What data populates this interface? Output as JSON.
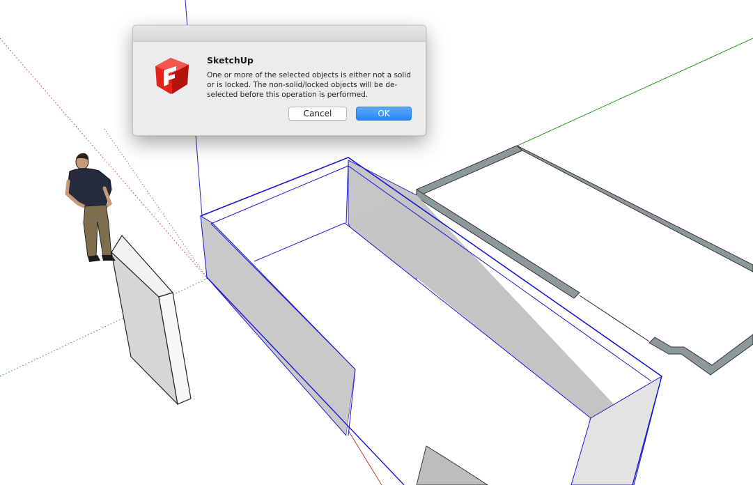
{
  "dialog": {
    "app_icon": "sketchup-logo-icon",
    "title": "SketchUp",
    "message": "One or more of the selected objects is either not a solid or is locked. The non-solid/locked objects will be de-selected before this operation is performed.",
    "cancel_label": "Cancel",
    "ok_label": "OK"
  },
  "viewport": {
    "selection_color": "#1515d6",
    "axis_colors": {
      "red": "#d03030",
      "green": "#1a9a1a",
      "blue": "#2323c8"
    },
    "face_color": "#c6c6c6",
    "logo_color": "#e2231a"
  }
}
